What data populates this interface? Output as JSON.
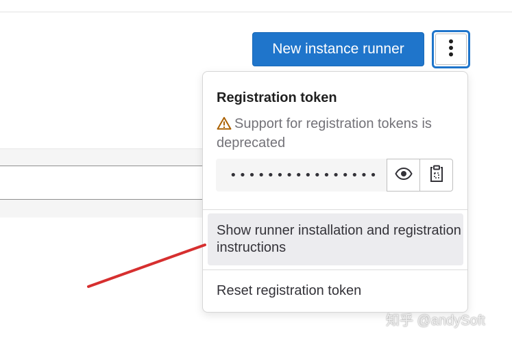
{
  "toolbar": {
    "new_runner_label": "New instance runner",
    "more_actions_icon": "vertical-ellipsis-icon"
  },
  "dropdown": {
    "title": "Registration token",
    "warning_icon": "warning-icon",
    "warning_text": "Support for registration tokens is deprecated",
    "token_masked": "••••••••••••••••",
    "reveal_icon": "eye-icon",
    "copy_icon": "clipboard-icon",
    "items": [
      {
        "label": "Show runner installation and registration instructions"
      },
      {
        "label": "Reset registration token"
      }
    ]
  },
  "watermark": "知乎 @andySoft",
  "colors": {
    "primary": "#1f75cb",
    "annotation_arrow": "#d62f2f",
    "warning": "#ab6100"
  }
}
